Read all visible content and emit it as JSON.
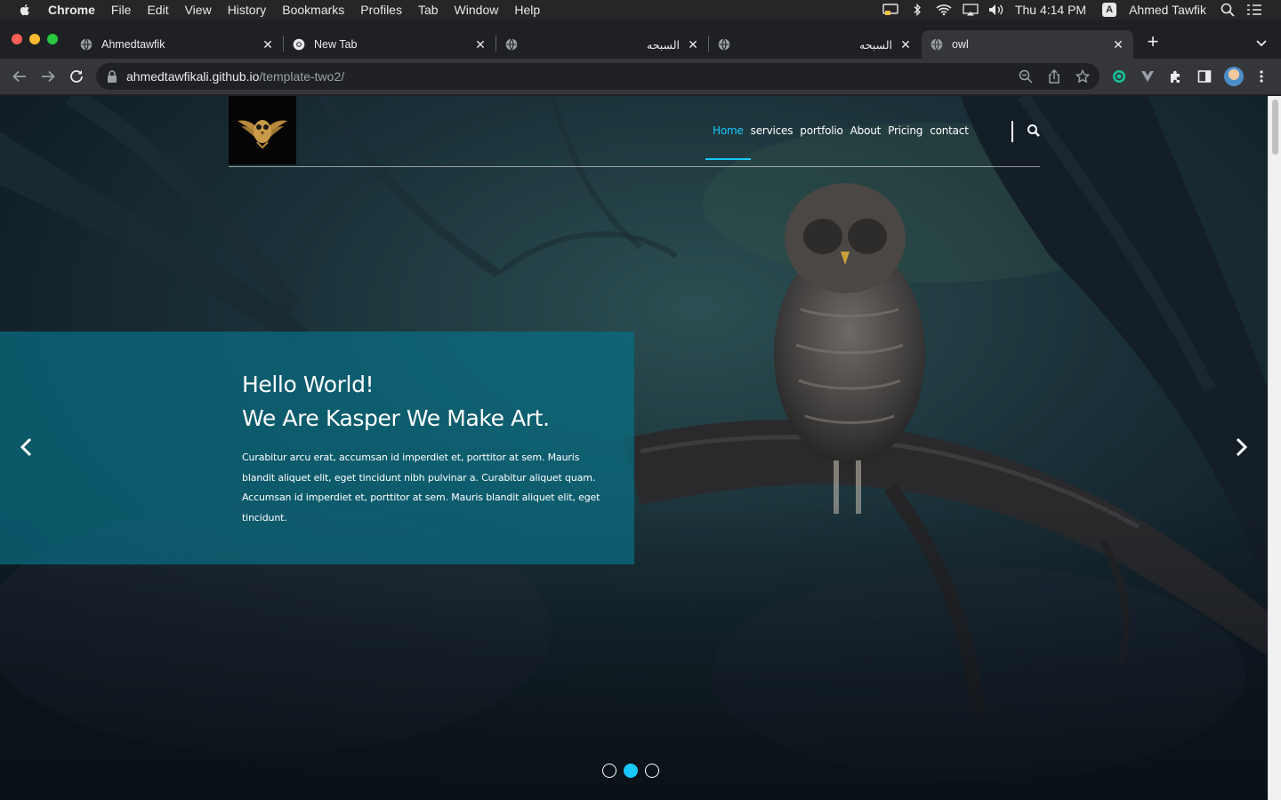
{
  "menubar": {
    "app_name": "Chrome",
    "items": [
      "File",
      "Edit",
      "View",
      "History",
      "Bookmarks",
      "Profiles",
      "Tab",
      "Window",
      "Help"
    ],
    "clock": "Thu 4:14 PM",
    "input_badge": "A",
    "user": "Ahmed Tawfik",
    "tray_icons": [
      "display-icon",
      "bluetooth-icon",
      "wifi-icon",
      "airplay-icon",
      "volume-icon",
      "spotlight-icon",
      "control-center-icon"
    ]
  },
  "browser": {
    "tabs": [
      {
        "title": "Ahmedtawfik",
        "favicon": "globe-icon",
        "active": false
      },
      {
        "title": "New Tab",
        "favicon": "chrome-icon",
        "active": false
      },
      {
        "title": "السبحه",
        "favicon": "globe-icon",
        "active": false
      },
      {
        "title": "السبحه",
        "favicon": "globe-icon",
        "active": false
      },
      {
        "title": "owl",
        "favicon": "globe-icon",
        "active": true
      }
    ],
    "new_tab_label": "+",
    "url_host": "ahmedtawfikali.github.io",
    "url_path": "/template-two2/"
  },
  "site": {
    "nav": [
      {
        "label": "Home",
        "active": true
      },
      {
        "label": "services",
        "active": false
      },
      {
        "label": "portfolio",
        "active": false
      },
      {
        "label": "About",
        "active": false
      },
      {
        "label": "Pricing",
        "active": false
      },
      {
        "label": "contact",
        "active": false
      }
    ],
    "hero": {
      "title_line1": "Hello World!",
      "title_line2": "We Are Kasper We Make Art.",
      "paragraph": "Curabitur arcu erat, accumsan id imperdiet et, porttitor at sem. Mauris blandit aliquet elit, eget tincidunt nibh pulvinar a. Curabitur aliquet quam. Accumsan id imperdiet et, porttitor at sem. Mauris blandit aliquet elit, eget tincidunt."
    },
    "slider": {
      "total": 3,
      "active_index": 1
    },
    "accent_color": "#19c8fa",
    "panel_color": "#086e82"
  }
}
